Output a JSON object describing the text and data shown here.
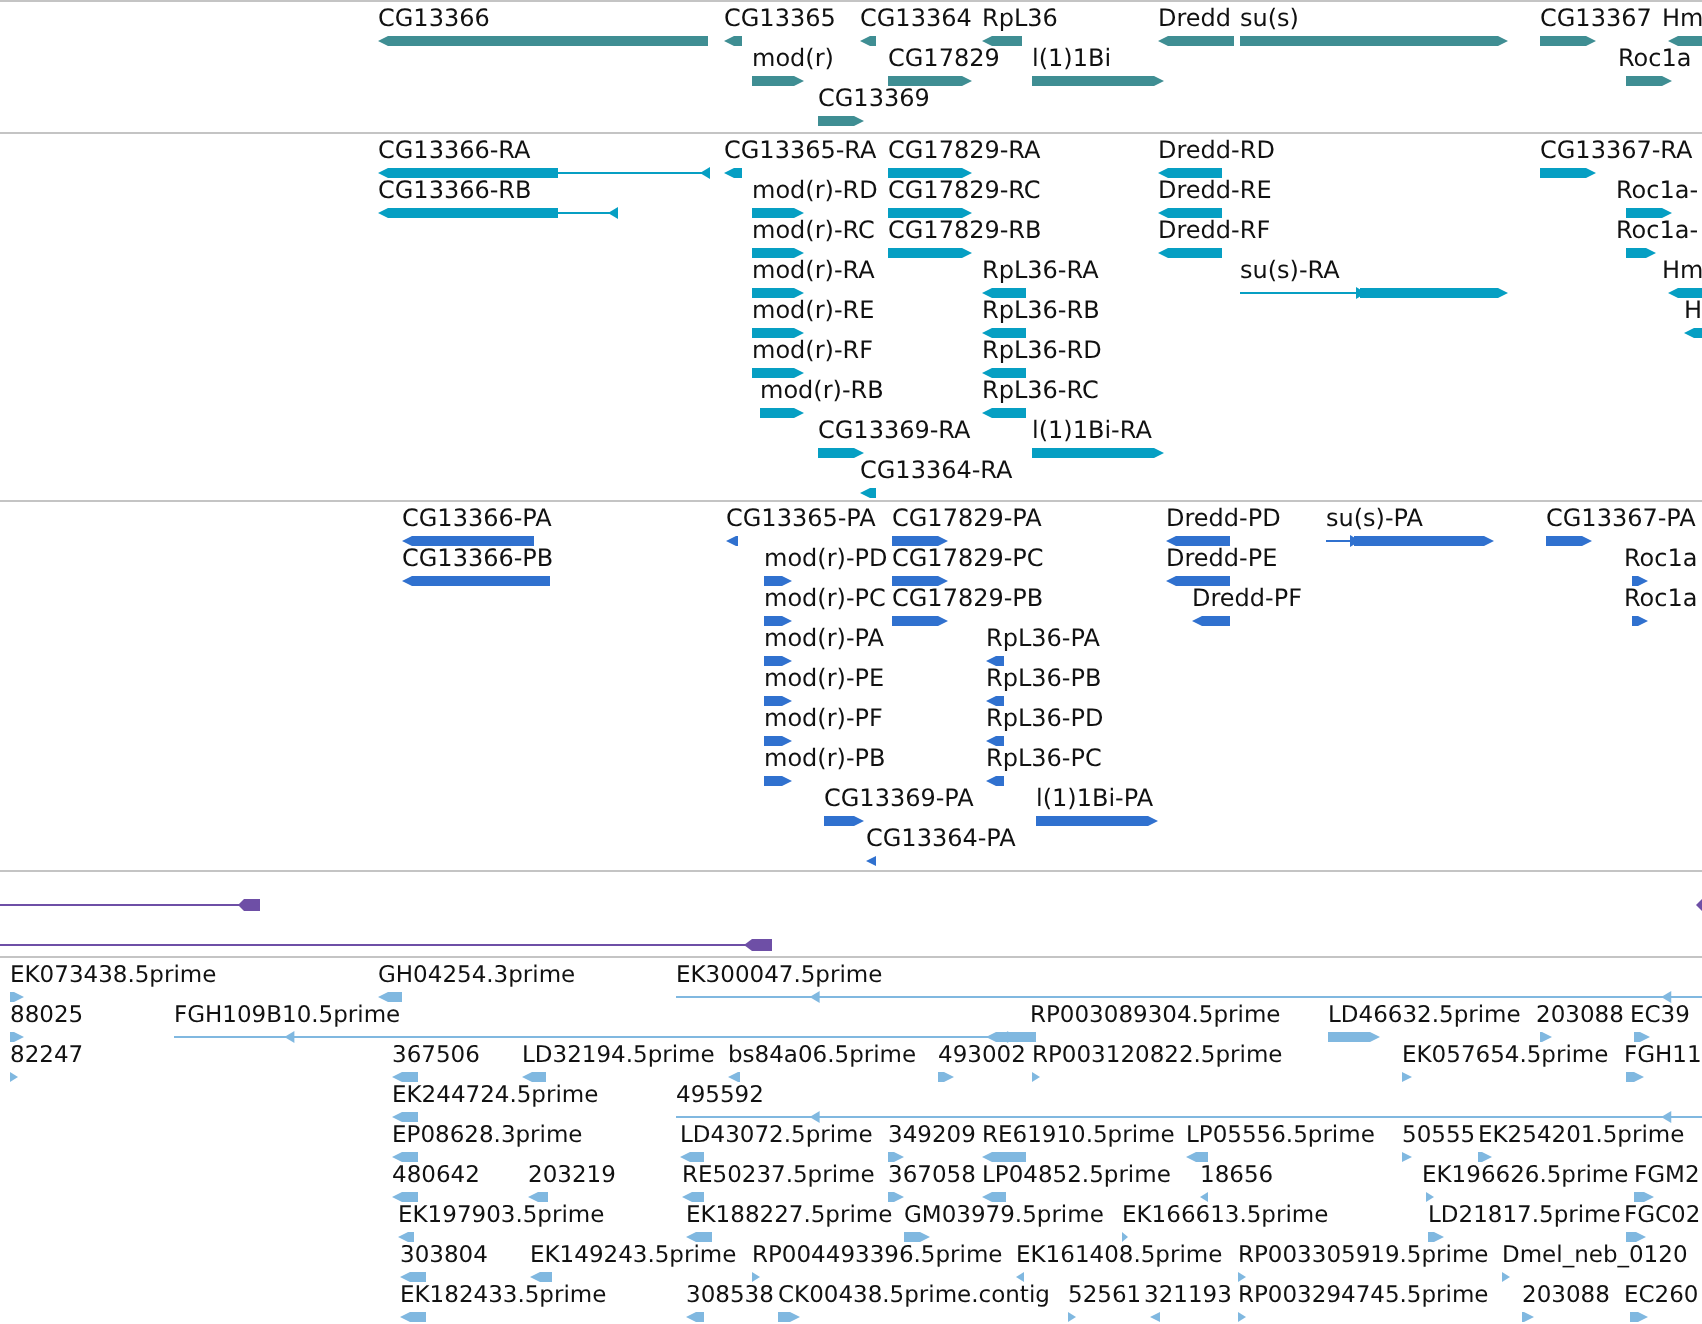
{
  "tracks": [
    {
      "kind": "genes",
      "features": [
        {
          "label": "CG13366",
          "reverse": true
        },
        {
          "label": "CG13365",
          "reverse": true
        },
        {
          "label": "CG13364",
          "reverse": true
        },
        {
          "label": "RpL36",
          "reverse": true
        },
        {
          "label": "Dredd",
          "reverse": true
        },
        {
          "label": "su(s)",
          "reverse": false
        },
        {
          "label": "CG13367",
          "reverse": false
        },
        {
          "label": "Hm",
          "reverse": true
        },
        {
          "label": "mod(r)",
          "reverse": false
        },
        {
          "label": "CG17829",
          "reverse": false
        },
        {
          "label": "l(1)1Bi",
          "reverse": false
        },
        {
          "label": "Roc1a",
          "reverse": false
        },
        {
          "label": "CG13369",
          "reverse": false
        }
      ]
    },
    {
      "kind": "transcripts",
      "features": [
        {
          "label": "CG13366-RA",
          "reverse": true
        },
        {
          "label": "CG13365-RA",
          "reverse": true
        },
        {
          "label": "CG17829-RA",
          "reverse": false
        },
        {
          "label": "Dredd-RD",
          "reverse": true
        },
        {
          "label": "CG13367-RA",
          "reverse": false
        },
        {
          "label": "CG13366-RB",
          "reverse": true
        },
        {
          "label": "mod(r)-RD",
          "reverse": false
        },
        {
          "label": "CG17829-RC",
          "reverse": false
        },
        {
          "label": "Dredd-RE",
          "reverse": true
        },
        {
          "label": "Roc1a-",
          "reverse": false
        },
        {
          "label": "mod(r)-RC",
          "reverse": false
        },
        {
          "label": "CG17829-RB",
          "reverse": false
        },
        {
          "label": "Dredd-RF",
          "reverse": true
        },
        {
          "label": "Roc1a-",
          "reverse": false
        },
        {
          "label": "mod(r)-RA",
          "reverse": false
        },
        {
          "label": "RpL36-RA",
          "reverse": true
        },
        {
          "label": "su(s)-RA",
          "reverse": false
        },
        {
          "label": "Hm",
          "reverse": true
        },
        {
          "label": "mod(r)-RE",
          "reverse": false
        },
        {
          "label": "RpL36-RB",
          "reverse": true
        },
        {
          "label": "H",
          "reverse": true
        },
        {
          "label": "mod(r)-RF",
          "reverse": false
        },
        {
          "label": "RpL36-RD",
          "reverse": true
        },
        {
          "label": "mod(r)-RB",
          "reverse": false
        },
        {
          "label": "RpL36-RC",
          "reverse": true
        },
        {
          "label": "CG13369-RA",
          "reverse": false
        },
        {
          "label": "l(1)1Bi-RA",
          "reverse": false
        },
        {
          "label": "CG13364-RA",
          "reverse": true
        }
      ]
    },
    {
      "kind": "proteins",
      "features": [
        {
          "label": "CG13366-PA",
          "reverse": true
        },
        {
          "label": "CG13365-PA",
          "reverse": true
        },
        {
          "label": "CG17829-PA",
          "reverse": false
        },
        {
          "label": "Dredd-PD",
          "reverse": true
        },
        {
          "label": "su(s)-PA",
          "reverse": false
        },
        {
          "label": "CG13367-PA",
          "reverse": false
        },
        {
          "label": "CG13366-PB",
          "reverse": true
        },
        {
          "label": "mod(r)-PD",
          "reverse": false
        },
        {
          "label": "CG17829-PC",
          "reverse": false
        },
        {
          "label": "Dredd-PE",
          "reverse": true
        },
        {
          "label": "Roc1a",
          "reverse": false
        },
        {
          "label": "mod(r)-PC",
          "reverse": false
        },
        {
          "label": "CG17829-PB",
          "reverse": false
        },
        {
          "label": "Dredd-PF",
          "reverse": true
        },
        {
          "label": "Roc1a",
          "reverse": false
        },
        {
          "label": "mod(r)-PA",
          "reverse": false
        },
        {
          "label": "RpL36-PA",
          "reverse": true
        },
        {
          "label": "mod(r)-PE",
          "reverse": false
        },
        {
          "label": "RpL36-PB",
          "reverse": true
        },
        {
          "label": "mod(r)-PF",
          "reverse": false
        },
        {
          "label": "RpL36-PD",
          "reverse": true
        },
        {
          "label": "mod(r)-PB",
          "reverse": false
        },
        {
          "label": "RpL36-PC",
          "reverse": true
        },
        {
          "label": "CG13369-PA",
          "reverse": false
        },
        {
          "label": "l(1)1Bi-PA",
          "reverse": false
        },
        {
          "label": "CG13364-PA",
          "reverse": true
        }
      ]
    },
    {
      "kind": "alignments"
    },
    {
      "kind": "ests",
      "features": [
        {
          "label": "EK073438.5prime",
          "reverse": false
        },
        {
          "label": "GH04254.3prime",
          "reverse": true
        },
        {
          "label": "EK300047.5prime",
          "reverse": true
        },
        {
          "label": "88025",
          "reverse": false
        },
        {
          "label": "FGH109B10.5prime",
          "reverse": true
        },
        {
          "label": "RP003089304.5prime",
          "reverse": true
        },
        {
          "label": "LD46632.5prime",
          "reverse": false
        },
        {
          "label": "203088",
          "reverse": false
        },
        {
          "label": "EC39",
          "reverse": false
        },
        {
          "label": "82247",
          "reverse": false
        },
        {
          "label": "367506",
          "reverse": true
        },
        {
          "label": "LD32194.5prime",
          "reverse": true
        },
        {
          "label": "bs84a06.5prime",
          "reverse": true
        },
        {
          "label": "493002",
          "reverse": false
        },
        {
          "label": "RP003120822.5prime",
          "reverse": false
        },
        {
          "label": "EK057654.5prime",
          "reverse": false
        },
        {
          "label": "FGH11",
          "reverse": false
        },
        {
          "label": "EK244724.5prime",
          "reverse": true
        },
        {
          "label": "495592",
          "reverse": true
        },
        {
          "label": "EP08628.3prime",
          "reverse": true
        },
        {
          "label": "LD43072.5prime",
          "reverse": true
        },
        {
          "label": "349209",
          "reverse": false
        },
        {
          "label": "RE61910.5prime",
          "reverse": true
        },
        {
          "label": "LP05556.5prime",
          "reverse": true
        },
        {
          "label": "50555",
          "reverse": false
        },
        {
          "label": "EK254201.5prime",
          "reverse": false
        },
        {
          "label": "480642",
          "reverse": true
        },
        {
          "label": "203219",
          "reverse": true
        },
        {
          "label": "RE50237.5prime",
          "reverse": true
        },
        {
          "label": "367058",
          "reverse": false
        },
        {
          "label": "LP04852.5prime",
          "reverse": true
        },
        {
          "label": "18656",
          "reverse": true
        },
        {
          "label": "EK196626.5prime",
          "reverse": false
        },
        {
          "label": "FGM2",
          "reverse": false
        },
        {
          "label": "EK197903.5prime",
          "reverse": true
        },
        {
          "label": "EK188227.5prime",
          "reverse": true
        },
        {
          "label": "GM03979.5prime",
          "reverse": false
        },
        {
          "label": "EK166613.5prime",
          "reverse": false
        },
        {
          "label": "LD21817.5prime",
          "reverse": false
        },
        {
          "label": "FGC02",
          "reverse": false
        },
        {
          "label": "303804",
          "reverse": true
        },
        {
          "label": "EK149243.5prime",
          "reverse": true
        },
        {
          "label": "RP004493396.5prime",
          "reverse": false
        },
        {
          "label": "EK161408.5prime",
          "reverse": true
        },
        {
          "label": "RP003305919.5prime",
          "reverse": false
        },
        {
          "label": "Dmel_neb_0120",
          "reverse": false
        },
        {
          "label": "EK182433.5prime",
          "reverse": true
        },
        {
          "label": "308538",
          "reverse": true
        },
        {
          "label": "CK00438.5prime.contig",
          "reverse": false
        },
        {
          "label": "52561",
          "reverse": false
        },
        {
          "label": "321193",
          "reverse": true
        },
        {
          "label": "RP003294745.5prime",
          "reverse": false
        },
        {
          "label": "203088",
          "reverse": false
        },
        {
          "label": "EC260",
          "reverse": false
        }
      ]
    }
  ]
}
